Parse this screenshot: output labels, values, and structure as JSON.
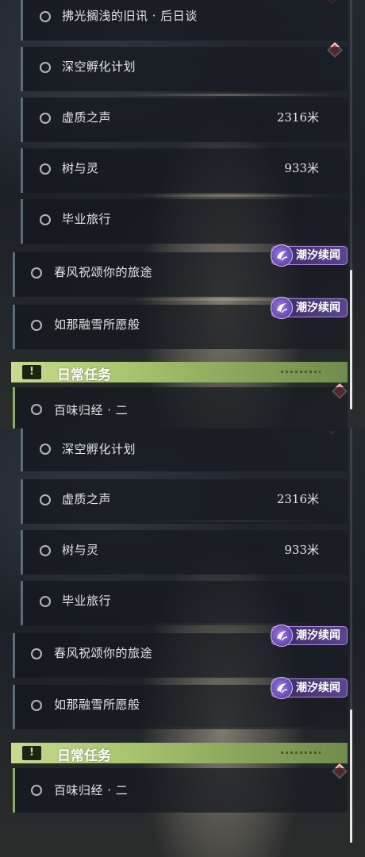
{
  "quests": {
    "q_past_news": "拂光搁浅的旧讯 · 后日谈",
    "q_deep_space": "深空孵化计划",
    "q_void": "虚质之声",
    "q_void_distance": "2316米",
    "q_tree": "树与灵",
    "q_tree_distance": "933米",
    "q_graduation": "毕业旅行",
    "q_spring_wind": "春风祝颂你的旅途",
    "q_melting_snow": "如那融雪所愿般",
    "q_flavors": "百味归经 · 二"
  },
  "tags": {
    "tide_tale": "潮汐续闻"
  },
  "section": {
    "daily_title": "日常任务",
    "daily_icon": "!"
  },
  "colors": {
    "accent_green": "#a9c46f",
    "tag_purple": "#5b4590",
    "alert_red": "#d8414c"
  },
  "icons": [
    "circle-status-icon",
    "wave-tag-icon",
    "exclamation-icon",
    "diamond-marker-icon",
    "chevron-down-icon"
  ]
}
